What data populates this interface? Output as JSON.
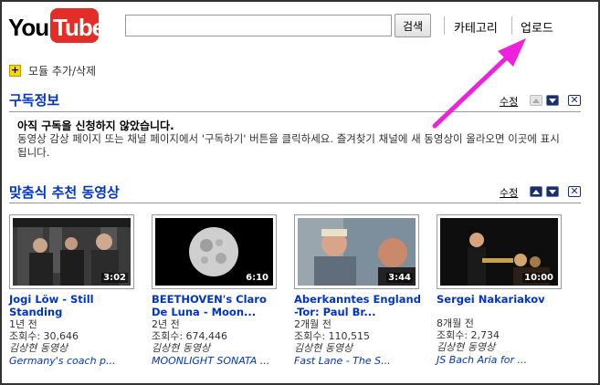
{
  "header": {
    "logo_you": "You",
    "logo_tube": "Tube",
    "search_value": "",
    "search_button": "검색",
    "nav_category": "카테고리",
    "nav_upload": "업로드"
  },
  "module_add": "모듈 추가/삭제",
  "subscriptions": {
    "title": "구독정보",
    "edit": "수정",
    "heading": "아직 구독을 신청하지 않았습니다.",
    "body": "동영상 감상 페이지 또는 채널 페이지에서 '구독하기' 버튼을 클릭하세요. 즐겨찾기 채널에 새 동영상이 올라오면 이곳에 표시됩니다."
  },
  "recommended": {
    "title": "맞춤식 추천 동영상",
    "edit": "수정",
    "videos": [
      {
        "title": "Jogi Löw - Still Standing",
        "duration": "3:02",
        "age": "1년 전",
        "views": "조회수: 30,646",
        "user": "김상현 동영상",
        "desc": "Germany's coach p..."
      },
      {
        "title": "BEETHOVEN's Claro De Luna - Moon...",
        "duration": "6:10",
        "age": "2년 전",
        "views": "조회수: 674,446",
        "user": "김상현 동영상",
        "desc": "MOONLIGHT SONATA ..."
      },
      {
        "title": "Aberkanntes England -Tor: Paul Br...",
        "duration": "3:44",
        "age": "2개월 전",
        "views": "조회수: 110,515",
        "user": "김상현 동영상",
        "desc": "Fast Lane - The S..."
      },
      {
        "title": "Sergei Nakariakov",
        "duration": "10:00",
        "age": "8개월 전",
        "views": "조회수: 2,734",
        "user": "김상현 동영상",
        "desc": "JS Bach Aria for ..."
      }
    ]
  },
  "colors": {
    "link": "#0033cc",
    "logo_red": "#e52d27",
    "arrow": "#ee22dd"
  }
}
